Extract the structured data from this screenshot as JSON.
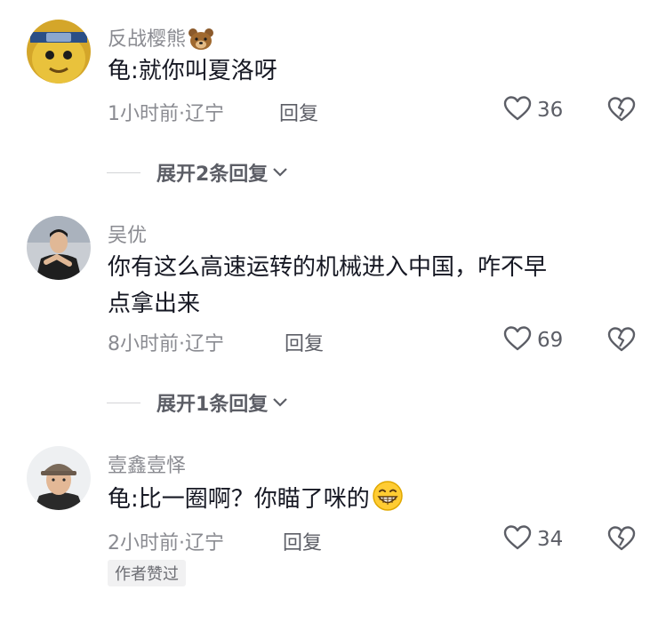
{
  "comments": [
    {
      "username": "反战樱熊",
      "username_emoji": "bear-emoji-icon",
      "text": "龟:就你叫夏洛呀",
      "time_location": "1小时前·辽宁",
      "reply_label": "回复",
      "likes": "36",
      "expand_label": "展开2条回复"
    },
    {
      "username": "吴优",
      "text_line1": "你有这么高速运转的机械进入中国，咋不早",
      "text_line2": "点拿出来",
      "time_location": "8小时前·辽宁",
      "reply_label": "回复",
      "likes": "69",
      "expand_label": "展开1条回复"
    },
    {
      "username": "壹鑫壹怿",
      "text": "龟:比一圈啊？你瞄了咪的",
      "text_emoji": "grinning-face-icon",
      "time_location": "2小时前·辽宁",
      "reply_label": "回复",
      "likes": "34",
      "badge": "作者赞过"
    }
  ],
  "colors": {
    "text_primary": "#161823",
    "text_secondary": "#8a8b91",
    "icon": "#5c5e66"
  }
}
